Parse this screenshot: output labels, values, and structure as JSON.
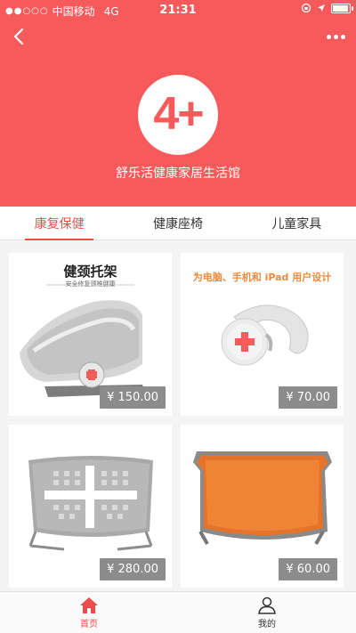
{
  "status_bar": {
    "signal_dots": "●●○○○",
    "carrier": "中国移动",
    "network": "4G",
    "time": "21:31",
    "battery_level": 0.85
  },
  "header": {
    "logo_text": "4+",
    "shop_name": "舒乐活健康家居生活馆",
    "background_color": "#f65a5a"
  },
  "icons": {
    "back": "chevron-left-icon",
    "more": "more-dots-icon",
    "home": "home-icon",
    "profile": "user-icon"
  },
  "tabs": [
    {
      "label": "康复保健",
      "active": true
    },
    {
      "label": "健康座椅",
      "active": false
    },
    {
      "label": "儿童家具",
      "active": false
    }
  ],
  "products": [
    {
      "title": "健颈托架",
      "subtitle": "安全修复颈椎健康",
      "price": "¥ 150.00"
    },
    {
      "banner": "为电脑、手机和 iPad 用户设计",
      "price": "¥ 70.00"
    },
    {
      "price": "¥ 280.00"
    },
    {
      "price": "¥ 60.00"
    }
  ],
  "tabbar": [
    {
      "label": "首页",
      "active": true
    },
    {
      "label": "我的",
      "active": false
    }
  ],
  "accent_color": "#f04b4b"
}
